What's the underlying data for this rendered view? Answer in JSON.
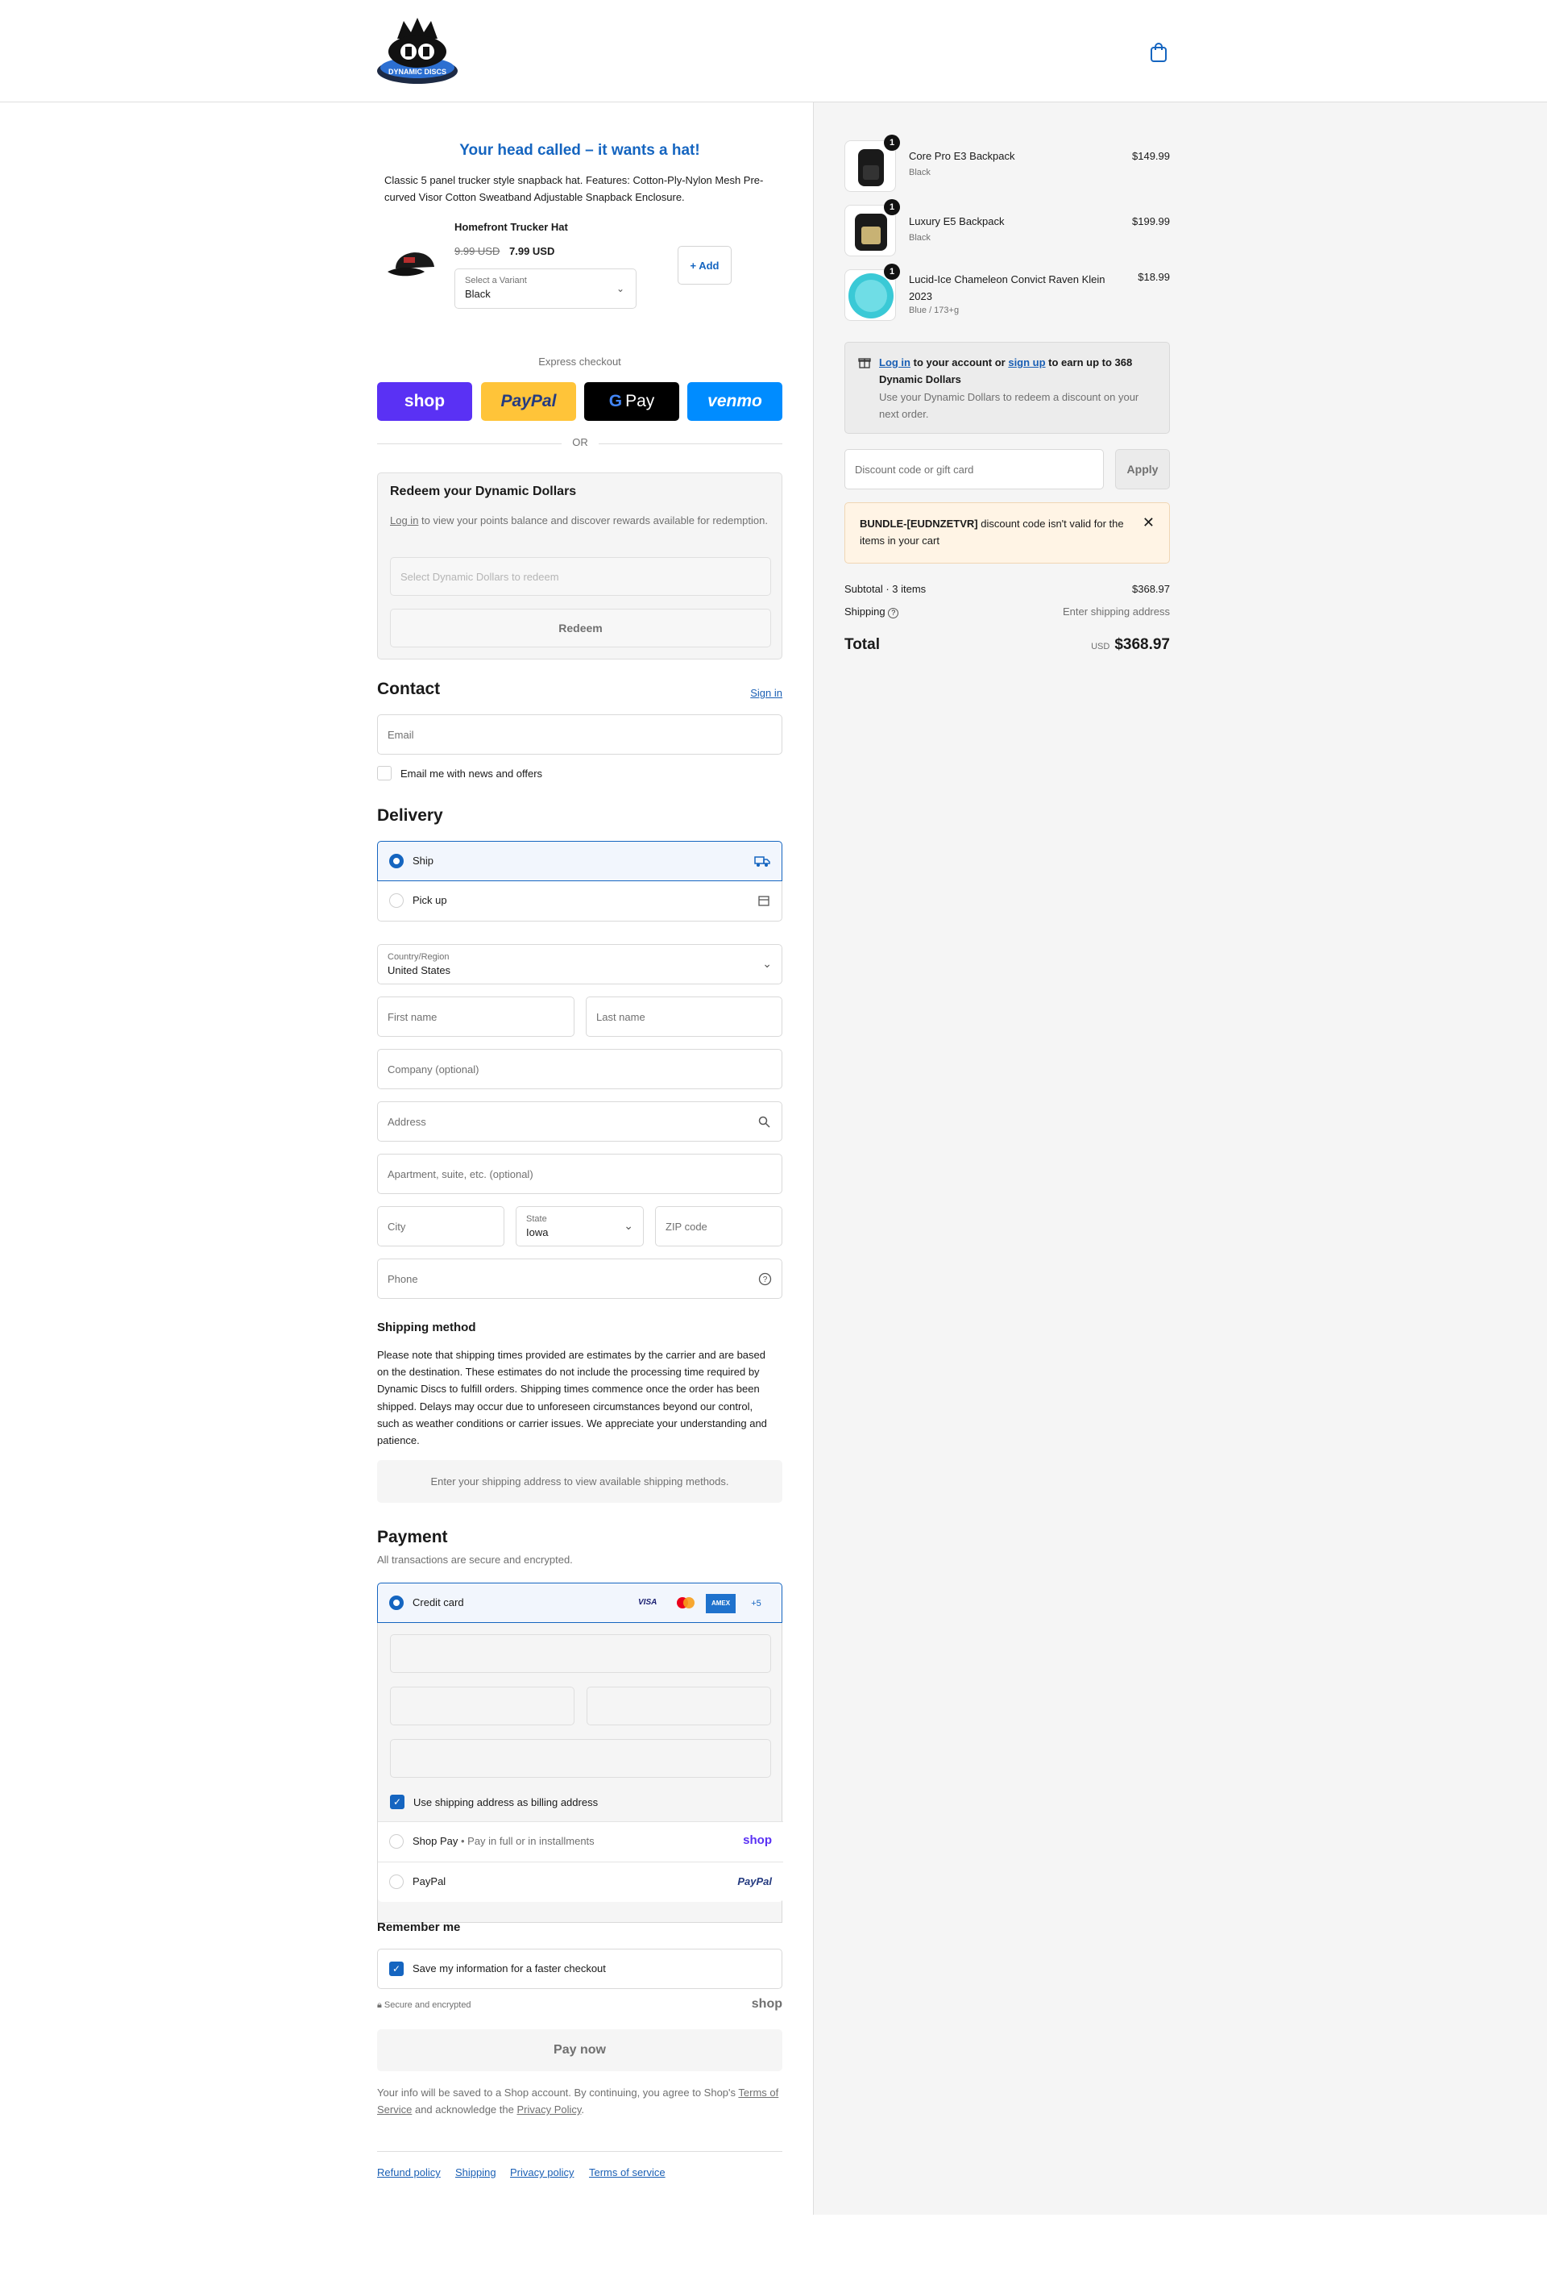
{
  "header": {
    "logo_text": "DYNAMIC DISCS",
    "cart_icon": "shopping-bag-icon"
  },
  "upsell": {
    "title": "Your head called – it wants a hat!",
    "description": "Classic 5 panel trucker style snapback hat. Features: Cotton-Ply-Nylon Mesh Pre-curved Visor Cotton Sweatband Adjustable Snapback Enclosure.",
    "product_name": "Homefront Trucker Hat",
    "old_price": "9.99 USD",
    "new_price": "7.99 USD",
    "variant_label": "Select a Variant",
    "variant_value": "Black",
    "add_label": "+ Add"
  },
  "express": {
    "label": "Express checkout",
    "shop": "shop",
    "paypal": "PayPal",
    "gpay": "Pay",
    "venmo": "venmo",
    "or": "OR"
  },
  "redeem": {
    "title": "Redeem your Dynamic Dollars",
    "login_link": "Log in",
    "desc_rest": " to view your points balance and discover rewards available for redemption.",
    "select_placeholder": "Select Dynamic Dollars to redeem",
    "button": "Redeem"
  },
  "contact": {
    "title": "Contact",
    "sign_in": "Sign in",
    "email_placeholder": "Email",
    "news_label": "Email me with news and offers"
  },
  "delivery": {
    "title": "Delivery",
    "ship_label": "Ship",
    "pickup_label": "Pick up",
    "country_label": "Country/Region",
    "country_value": "United States",
    "first_name": "First name",
    "last_name": "Last name",
    "company": "Company (optional)",
    "address": "Address",
    "apartment": "Apartment, suite, etc. (optional)",
    "city": "City",
    "state_label": "State",
    "state_value": "Iowa",
    "zip": "ZIP code",
    "phone": "Phone"
  },
  "shipping_method": {
    "title": "Shipping method",
    "notice": "Please note that shipping times provided are estimates by the carrier and are based on the destination. These estimates do not include the processing time required by Dynamic Discs to fulfill orders. Shipping times commence once the order has been shipped. Delays may occur due to unforeseen circumstances beyond our control, such as weather conditions or carrier issues. We appreciate your understanding and patience.",
    "placeholder": "Enter your shipping address to view available shipping methods."
  },
  "payment": {
    "title": "Payment",
    "subtitle": "All transactions are secure and encrypted.",
    "credit_card": "Credit card",
    "visa": "VISA",
    "amex": "AMEX",
    "more": "+5",
    "billing_label": "Use shipping address as billing address",
    "shop_pay": "Shop Pay",
    "shop_pay_desc": "Pay in full or in installments",
    "shop_logo": "shop",
    "paypal": "PayPal",
    "paypal_logo": "PayPal"
  },
  "remember": {
    "title": "Remember me",
    "save_label": "Save my information for a faster checkout",
    "secure": "Secure and encrypted",
    "shop_logo": "shop",
    "pay_button": "Pay now",
    "legal_prefix": "Your info will be saved to a Shop account. By continuing, you agree to Shop's ",
    "terms": "Terms of Service",
    "legal_mid": " and acknowledge the ",
    "privacy": "Privacy Policy",
    "legal_end": "."
  },
  "footer": {
    "links": [
      "Refund policy",
      "Shipping",
      "Privacy policy",
      "Terms of service"
    ]
  },
  "cart": {
    "items": [
      {
        "qty": "1",
        "name": "Core Pro E3 Backpack",
        "variant": "Black",
        "price": "$149.99"
      },
      {
        "qty": "1",
        "name": "Luxury E5 Backpack",
        "variant": "Black",
        "price": "$199.99"
      },
      {
        "qty": "1",
        "name": "Lucid-Ice Chameleon Convict Raven Klein 2023",
        "variant": "Blue / 173+g",
        "price": "$18.99"
      }
    ],
    "rewards": {
      "login": "Log in",
      "mid": " to your account or ",
      "signup": "sign up",
      "rest": " to earn up to 368 Dynamic Dollars",
      "sub": "Use your Dynamic Dollars to redeem a discount on your next order."
    },
    "discount_placeholder": "Discount code or gift card",
    "apply": "Apply",
    "error_code": "BUNDLE-[EUDNZETVR]",
    "error_rest": " discount code isn't valid for the items in your cart",
    "subtotal_label": "Subtotal · 3 items",
    "subtotal_value": "$368.97",
    "shipping_label": "Shipping",
    "shipping_value": "Enter shipping address",
    "total_label": "Total",
    "currency": "USD",
    "total_value": "$368.97"
  }
}
